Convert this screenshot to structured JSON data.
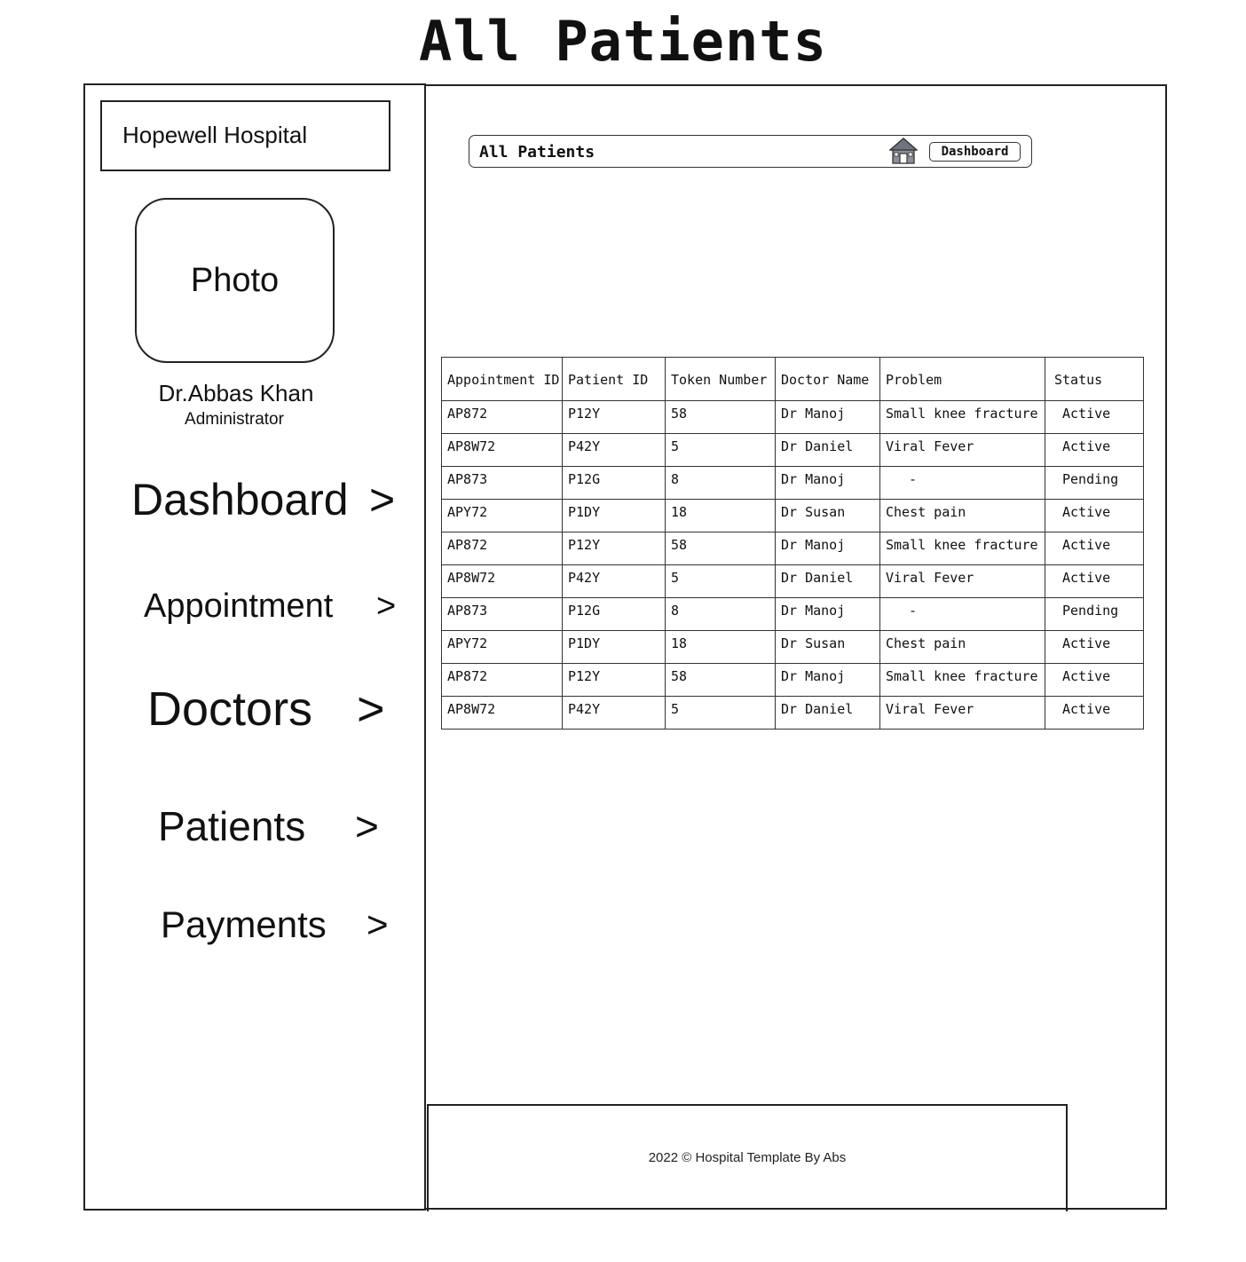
{
  "page": {
    "title": "All Patients"
  },
  "sidebar": {
    "hospital_name": "Hopewell Hospital",
    "photo_label": "Photo",
    "user_name": "Dr.Abbas Khan",
    "user_role": "Administrator",
    "nav": [
      {
        "label": "Dashboard",
        "chevron": ">"
      },
      {
        "label": "Appointment",
        "chevron": ">"
      },
      {
        "label": "Doctors",
        "chevron": ">"
      },
      {
        "label": "Patients",
        "chevron": ">"
      },
      {
        "label": "Payments",
        "chevron": ">"
      }
    ]
  },
  "breadcrumb": {
    "title": "All Patients",
    "icon": "home-icon",
    "button_label": "Dashboard"
  },
  "table": {
    "columns": [
      "Appointment ID",
      "Patient ID",
      "Token Number",
      "Doctor Name",
      "Problem",
      "Status"
    ],
    "rows": [
      [
        "AP872",
        "P12Y",
        "58",
        "Dr Manoj",
        "Small knee fracture",
        "Active"
      ],
      [
        "AP8W72",
        "P42Y",
        "5",
        "Dr Daniel",
        "Viral Fever",
        "Active"
      ],
      [
        "AP873",
        "P12G",
        "8",
        "Dr Manoj",
        "-",
        "Pending"
      ],
      [
        "APY72",
        "P1DY",
        "18",
        "Dr Susan",
        "Chest pain",
        "Active"
      ],
      [
        "AP872",
        "P12Y",
        "58",
        "Dr Manoj",
        "Small knee fracture",
        "Active"
      ],
      [
        "AP8W72",
        "P42Y",
        "5",
        "Dr Daniel",
        "Viral Fever",
        "Active"
      ],
      [
        "AP873",
        "P12G",
        "8",
        "Dr Manoj",
        "-",
        "Pending"
      ],
      [
        "APY72",
        "P1DY",
        "18",
        "Dr Susan",
        "Chest pain",
        "Active"
      ],
      [
        "AP872",
        "P12Y",
        "58",
        "Dr Manoj",
        "Small knee fracture",
        "Active"
      ],
      [
        "AP8W72",
        "P42Y",
        "5",
        "Dr Daniel",
        "Viral Fever",
        "Active"
      ]
    ]
  },
  "footer": {
    "text": "2022 ©  Hospital Template By Abs"
  }
}
